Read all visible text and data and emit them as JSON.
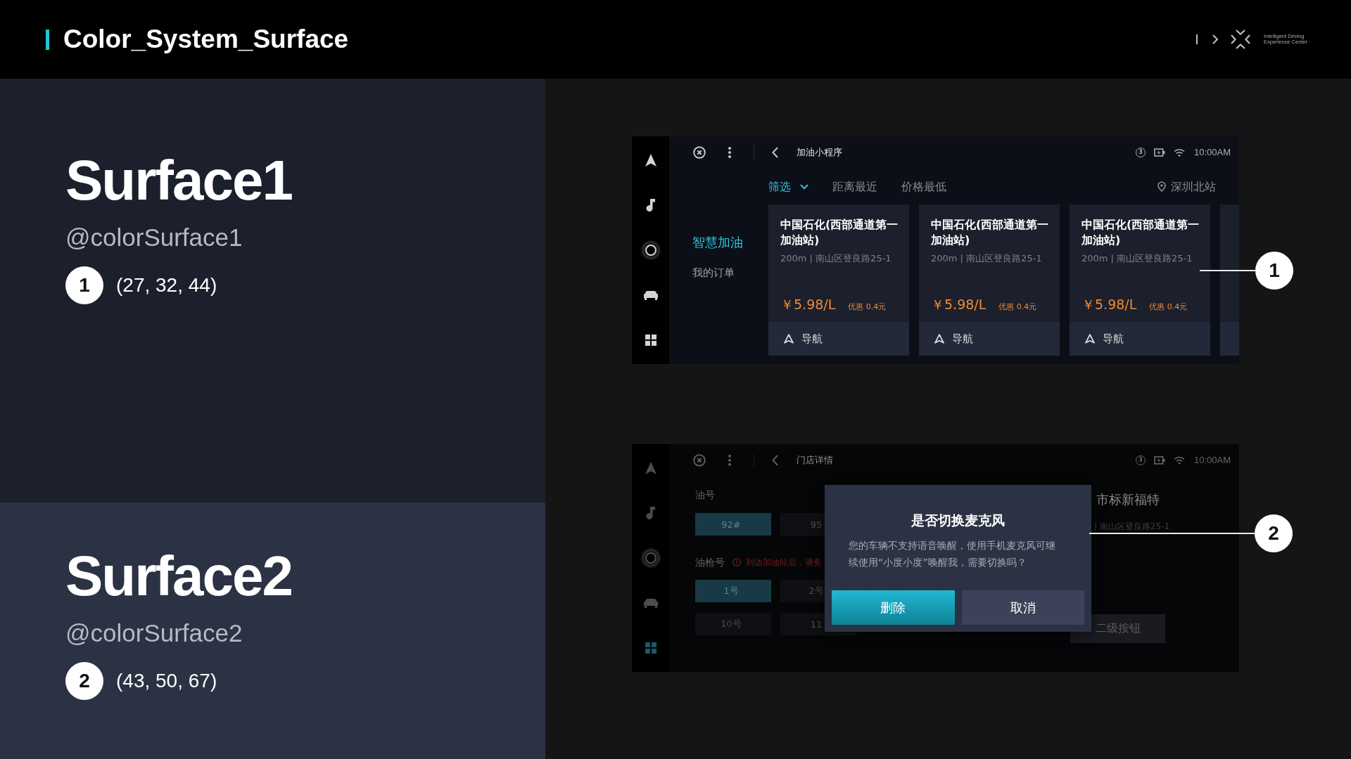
{
  "header": {
    "title": "Color_System_Surface",
    "logo_text": "Intelligent Driving Experience Center"
  },
  "swatches": [
    {
      "name": "Surface1",
      "token": "@colorSurface1",
      "number": "1",
      "rgb": "(27, 32, 44)",
      "color": "#1b202c"
    },
    {
      "name": "Surface2",
      "token": "@colorSurface2",
      "number": "2",
      "rgb": "(43, 50, 67)",
      "color": "#2b3243"
    }
  ],
  "screens": [
    {
      "kind": "list",
      "marker": "1",
      "sidebar": [
        {
          "selected": false
        },
        {
          "selected": false
        },
        {
          "selected": false
        },
        {
          "selected": false
        },
        {
          "selected": false
        }
      ],
      "title": "加油小程序",
      "notification_count": "3",
      "time": "10:00AM",
      "filters": [
        {
          "label": "筛选",
          "kind": "dropdown",
          "selected": true
        },
        {
          "label": "距离最近",
          "kind": "sort",
          "selected": false
        },
        {
          "label": "价格最低",
          "kind": "sort",
          "selected": false
        }
      ],
      "location": "深圳北站",
      "menu": [
        {
          "label": "智慧加油",
          "selected": true
        },
        {
          "label": "我的订单",
          "selected": false
        }
      ],
      "stations": [
        {
          "kind": "full",
          "name": "中国石化(西部通道第一加油站)",
          "address": "200m | 南山区登良路25-1",
          "price": "￥5.98/L",
          "discount": "优惠 0.4元",
          "action": "导航"
        },
        {
          "kind": "full",
          "name": "中国石化(西部通道第一加油站)",
          "address": "200m | 南山区登良路25-1",
          "price": "￥5.98/L",
          "discount": "优惠 0.4元",
          "action": "导航"
        },
        {
          "kind": "full",
          "name": "中国石化(西部通道第一加油站)",
          "address": "200m | 南山区登良路25-1",
          "price": "￥5.98/L",
          "discount": "优惠 0.4元",
          "action": "导航"
        },
        {
          "kind": "cut"
        }
      ]
    },
    {
      "kind": "detail",
      "marker": "2",
      "sidebar": [
        {
          "selected": false
        },
        {
          "selected": false
        },
        {
          "selected": false
        },
        {
          "selected": false
        },
        {
          "selected": true
        }
      ],
      "title": "门店详情",
      "notification_count": "3",
      "time": "10:00AM",
      "fuel_label": "油号",
      "fuel_options": [
        {
          "label": "92#",
          "selected": true
        },
        {
          "label": "95",
          "selected": false
        }
      ],
      "pump_label": "油枪号",
      "notice": "到达加油站后，请务",
      "pumps": [
        {
          "label": "1号",
          "selected": true
        },
        {
          "label": "2号",
          "selected": false
        },
        {
          "label": "10号",
          "selected": false
        },
        {
          "label": "11",
          "selected": false
        }
      ],
      "station_name": "市标新福特",
      "address": "| 南山区登良路25-1",
      "secondary_button": "二级按钮",
      "dialog": {
        "title": "是否切换麦克风",
        "message": "您的车辆不支持语音唤醒，使用手机麦克风可继续使用“小度小度”唤醒我，需要切换吗？",
        "buttons": [
          {
            "label": "删除",
            "kind": "primary"
          },
          {
            "label": "取消",
            "kind": "secondary"
          }
        ]
      }
    }
  ]
}
